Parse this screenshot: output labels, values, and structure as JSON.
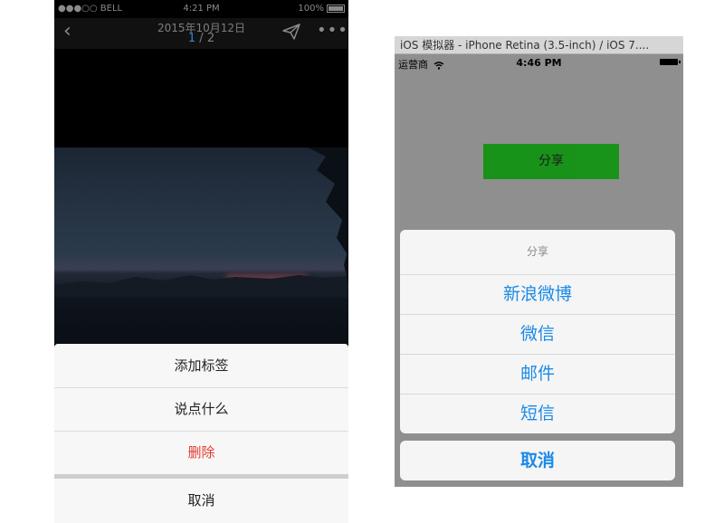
{
  "left": {
    "status": {
      "carrier": "●●●○○ BELL",
      "time": "4:21 PM",
      "battery": "100%"
    },
    "nav": {
      "date": "2015年10月12日",
      "page_current": "1",
      "page_sep": " / ",
      "page_total": "2"
    },
    "sheet": {
      "items": [
        "添加标签",
        "说点什么",
        "删除"
      ],
      "cancel": "取消"
    }
  },
  "right": {
    "window_title": "iOS 模拟器 - iPhone Retina (3.5-inch) / iOS 7....",
    "status": {
      "carrier": "运营商",
      "time": "4:46 PM"
    },
    "share_button": "分享",
    "sheet": {
      "title": "分享",
      "options": [
        "新浪微博",
        "微信",
        "邮件",
        "短信"
      ],
      "cancel": "取消"
    }
  },
  "colors": {
    "danger": "#e23b2e",
    "ios_blue": "#1a8ae8",
    "share_green": "#0c930c"
  }
}
